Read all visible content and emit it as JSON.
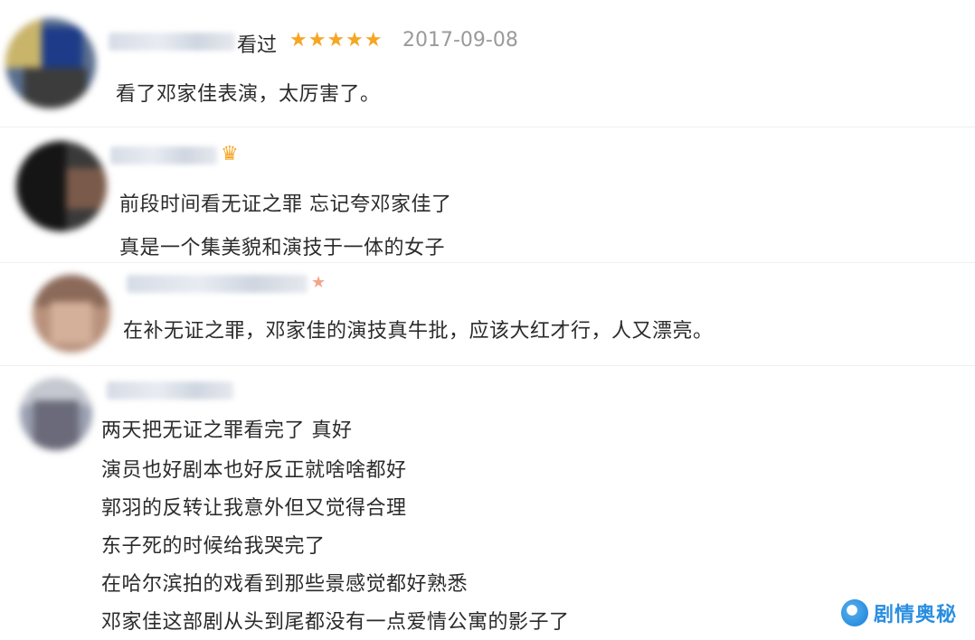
{
  "colors": {
    "star": "#f5a623",
    "date": "#9a9a9a",
    "watermark": "#2a8ee0"
  },
  "comments": [
    {
      "meta": "看过",
      "rating": "★★★★★",
      "date": "2017-09-08",
      "lines": [
        "看了邓家佳表演，太厉害了。"
      ]
    },
    {
      "badge": "crown-icon",
      "lines": [
        "前段时间看无证之罪 忘记夸邓家佳了",
        "真是一个集美貌和演技于一体的女子"
      ]
    },
    {
      "lines": [
        "在补无证之罪，邓家佳的演技真牛批，应该大红才行，人又漂亮。"
      ]
    },
    {
      "lines": [
        "两天把无证之罪看完了 真好",
        "演员也好剧本也好反正就啥啥都好",
        "郭羽的反转让我意外但又觉得合理",
        "东子死的时候给我哭完了",
        "在哈尔滨拍的戏看到那些景感觉都好熟悉",
        "邓家佳这部剧从头到尾都没有一点爱情公寓的影子了"
      ]
    }
  ],
  "watermark": {
    "text": "剧情奥秘",
    "icon": "logo-icon"
  }
}
